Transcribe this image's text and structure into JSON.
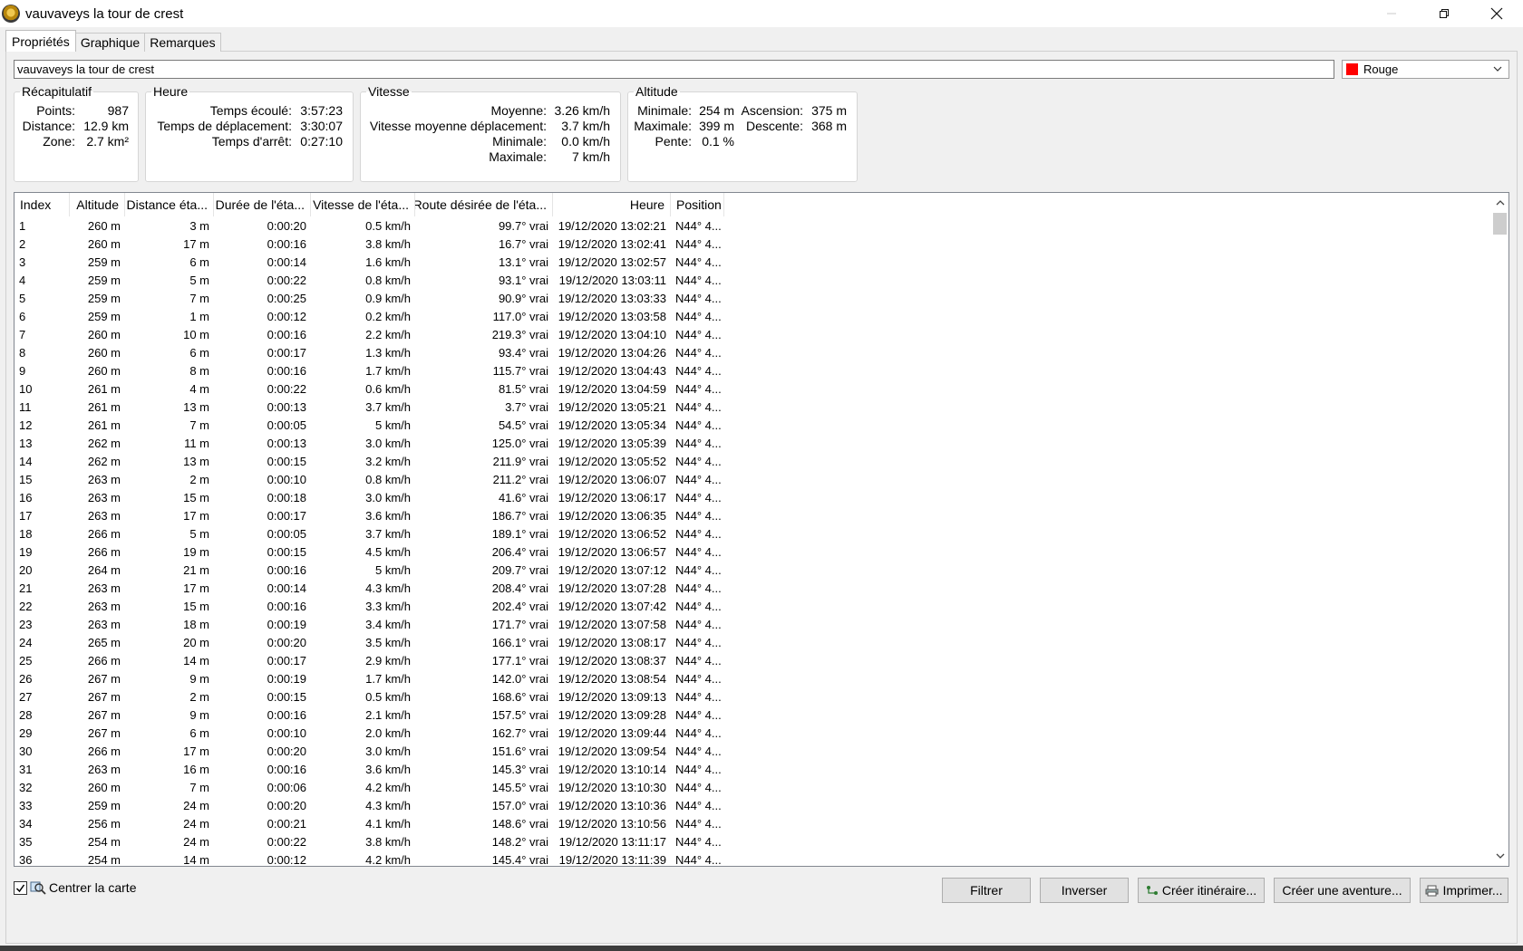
{
  "window": {
    "title": "vauvaveys la tour de crest"
  },
  "tabs": [
    {
      "label": "Propriétés"
    },
    {
      "label": "Graphique"
    },
    {
      "label": "Remarques"
    }
  ],
  "name_field": {
    "value": "vauvaveys la tour de crest"
  },
  "color_select": {
    "value": "Rouge",
    "swatch_color": "#ff0000"
  },
  "recap": {
    "title": "Récapitulatif",
    "points_label": "Points:",
    "points_value": "987",
    "distance_label": "Distance:",
    "distance_value": "12.9 km",
    "zone_label": "Zone:",
    "zone_value": "2.7 km²"
  },
  "heure": {
    "title": "Heure",
    "elapsed_label": "Temps écoulé:",
    "elapsed_value": "3:57:23",
    "moving_label": "Temps de déplacement:",
    "moving_value": "3:30:07",
    "stop_label": "Temps d'arrêt:",
    "stop_value": "0:27:10"
  },
  "vitesse": {
    "title": "Vitesse",
    "avg_label": "Moyenne:",
    "avg_value": "3.26 km/h",
    "moving_avg_label": "Vitesse moyenne déplacement:",
    "moving_avg_value": "3.7 km/h",
    "min_label": "Minimale:",
    "min_value": "0.0 km/h",
    "max_label": "Maximale:",
    "max_value": "7 km/h"
  },
  "altitude": {
    "title": "Altitude",
    "min_label": "Minimale:",
    "min_value": "254 m",
    "max_label": "Maximale:",
    "max_value": "399 m",
    "slope_label": "Pente:",
    "slope_value": "0.1 %",
    "ascent_label": "Ascension:",
    "ascent_value": "375 m",
    "descent_label": "Descente:",
    "descent_value": "368 m"
  },
  "table": {
    "columns": [
      "Index",
      "Altitude",
      "Distance éta...",
      "Durée de l'éta...",
      "Vitesse de l'éta...",
      "Route désirée de l'éta...",
      "Heure",
      "Position"
    ],
    "rows": [
      [
        "1",
        "260 m",
        "3 m",
        "0:00:20",
        "0.5 km/h",
        "99.7° vrai",
        "19/12/2020 13:02:21",
        "N44° 4..."
      ],
      [
        "2",
        "260 m",
        "17 m",
        "0:00:16",
        "3.8 km/h",
        "16.7° vrai",
        "19/12/2020 13:02:41",
        "N44° 4..."
      ],
      [
        "3",
        "259 m",
        "6 m",
        "0:00:14",
        "1.6 km/h",
        "13.1° vrai",
        "19/12/2020 13:02:57",
        "N44° 4..."
      ],
      [
        "4",
        "259 m",
        "5 m",
        "0:00:22",
        "0.8 km/h",
        "93.1° vrai",
        "19/12/2020 13:03:11",
        "N44° 4..."
      ],
      [
        "5",
        "259 m",
        "7 m",
        "0:00:25",
        "0.9 km/h",
        "90.9° vrai",
        "19/12/2020 13:03:33",
        "N44° 4..."
      ],
      [
        "6",
        "259 m",
        "1 m",
        "0:00:12",
        "0.2 km/h",
        "117.0° vrai",
        "19/12/2020 13:03:58",
        "N44° 4..."
      ],
      [
        "7",
        "260 m",
        "10 m",
        "0:00:16",
        "2.2 km/h",
        "219.3° vrai",
        "19/12/2020 13:04:10",
        "N44° 4..."
      ],
      [
        "8",
        "260 m",
        "6 m",
        "0:00:17",
        "1.3 km/h",
        "93.4° vrai",
        "19/12/2020 13:04:26",
        "N44° 4..."
      ],
      [
        "9",
        "260 m",
        "8 m",
        "0:00:16",
        "1.7 km/h",
        "115.7° vrai",
        "19/12/2020 13:04:43",
        "N44° 4..."
      ],
      [
        "10",
        "261 m",
        "4 m",
        "0:00:22",
        "0.6 km/h",
        "81.5° vrai",
        "19/12/2020 13:04:59",
        "N44° 4..."
      ],
      [
        "11",
        "261 m",
        "13 m",
        "0:00:13",
        "3.7 km/h",
        "3.7° vrai",
        "19/12/2020 13:05:21",
        "N44° 4..."
      ],
      [
        "12",
        "261 m",
        "7 m",
        "0:00:05",
        "5 km/h",
        "54.5° vrai",
        "19/12/2020 13:05:34",
        "N44° 4..."
      ],
      [
        "13",
        "262 m",
        "11 m",
        "0:00:13",
        "3.0 km/h",
        "125.0° vrai",
        "19/12/2020 13:05:39",
        "N44° 4..."
      ],
      [
        "14",
        "262 m",
        "13 m",
        "0:00:15",
        "3.2 km/h",
        "211.9° vrai",
        "19/12/2020 13:05:52",
        "N44° 4..."
      ],
      [
        "15",
        "263 m",
        "2 m",
        "0:00:10",
        "0.8 km/h",
        "211.2° vrai",
        "19/12/2020 13:06:07",
        "N44° 4..."
      ],
      [
        "16",
        "263 m",
        "15 m",
        "0:00:18",
        "3.0 km/h",
        "41.6° vrai",
        "19/12/2020 13:06:17",
        "N44° 4..."
      ],
      [
        "17",
        "263 m",
        "17 m",
        "0:00:17",
        "3.6 km/h",
        "186.7° vrai",
        "19/12/2020 13:06:35",
        "N44° 4..."
      ],
      [
        "18",
        "266 m",
        "5 m",
        "0:00:05",
        "3.7 km/h",
        "189.1° vrai",
        "19/12/2020 13:06:52",
        "N44° 4..."
      ],
      [
        "19",
        "266 m",
        "19 m",
        "0:00:15",
        "4.5 km/h",
        "206.4° vrai",
        "19/12/2020 13:06:57",
        "N44° 4..."
      ],
      [
        "20",
        "264 m",
        "21 m",
        "0:00:16",
        "5 km/h",
        "209.7° vrai",
        "19/12/2020 13:07:12",
        "N44° 4..."
      ],
      [
        "21",
        "263 m",
        "17 m",
        "0:00:14",
        "4.3 km/h",
        "208.4° vrai",
        "19/12/2020 13:07:28",
        "N44° 4..."
      ],
      [
        "22",
        "263 m",
        "15 m",
        "0:00:16",
        "3.3 km/h",
        "202.4° vrai",
        "19/12/2020 13:07:42",
        "N44° 4..."
      ],
      [
        "23",
        "263 m",
        "18 m",
        "0:00:19",
        "3.4 km/h",
        "171.7° vrai",
        "19/12/2020 13:07:58",
        "N44° 4..."
      ],
      [
        "24",
        "265 m",
        "20 m",
        "0:00:20",
        "3.5 km/h",
        "166.1° vrai",
        "19/12/2020 13:08:17",
        "N44° 4..."
      ],
      [
        "25",
        "266 m",
        "14 m",
        "0:00:17",
        "2.9 km/h",
        "177.1° vrai",
        "19/12/2020 13:08:37",
        "N44° 4..."
      ],
      [
        "26",
        "267 m",
        "9 m",
        "0:00:19",
        "1.7 km/h",
        "142.0° vrai",
        "19/12/2020 13:08:54",
        "N44° 4..."
      ],
      [
        "27",
        "267 m",
        "2 m",
        "0:00:15",
        "0.5 km/h",
        "168.6° vrai",
        "19/12/2020 13:09:13",
        "N44° 4..."
      ],
      [
        "28",
        "267 m",
        "9 m",
        "0:00:16",
        "2.1 km/h",
        "157.5° vrai",
        "19/12/2020 13:09:28",
        "N44° 4..."
      ],
      [
        "29",
        "267 m",
        "6 m",
        "0:00:10",
        "2.0 km/h",
        "162.7° vrai",
        "19/12/2020 13:09:44",
        "N44° 4..."
      ],
      [
        "30",
        "266 m",
        "17 m",
        "0:00:20",
        "3.0 km/h",
        "151.6° vrai",
        "19/12/2020 13:09:54",
        "N44° 4..."
      ],
      [
        "31",
        "263 m",
        "16 m",
        "0:00:16",
        "3.6 km/h",
        "145.3° vrai",
        "19/12/2020 13:10:14",
        "N44° 4..."
      ],
      [
        "32",
        "260 m",
        "7 m",
        "0:00:06",
        "4.2 km/h",
        "145.5° vrai",
        "19/12/2020 13:10:30",
        "N44° 4..."
      ],
      [
        "33",
        "259 m",
        "24 m",
        "0:00:20",
        "4.3 km/h",
        "157.0° vrai",
        "19/12/2020 13:10:36",
        "N44° 4..."
      ],
      [
        "34",
        "256 m",
        "24 m",
        "0:00:21",
        "4.1 km/h",
        "148.6° vrai",
        "19/12/2020 13:10:56",
        "N44° 4..."
      ],
      [
        "35",
        "254 m",
        "24 m",
        "0:00:22",
        "3.8 km/h",
        "148.2° vrai",
        "19/12/2020 13:11:17",
        "N44° 4..."
      ],
      [
        "36",
        "254 m",
        "14 m",
        "0:00:12",
        "4.2 km/h",
        "145.4° vrai",
        "19/12/2020 13:11:39",
        "N44° 4..."
      ]
    ]
  },
  "center_map": {
    "label": "Centrer la carte",
    "checked": true
  },
  "buttons": {
    "filter": "Filtrer",
    "invert": "Inverser",
    "create_route": "Créer itinéraire...",
    "create_adventure": "Créer une aventure...",
    "print": "Imprimer..."
  }
}
